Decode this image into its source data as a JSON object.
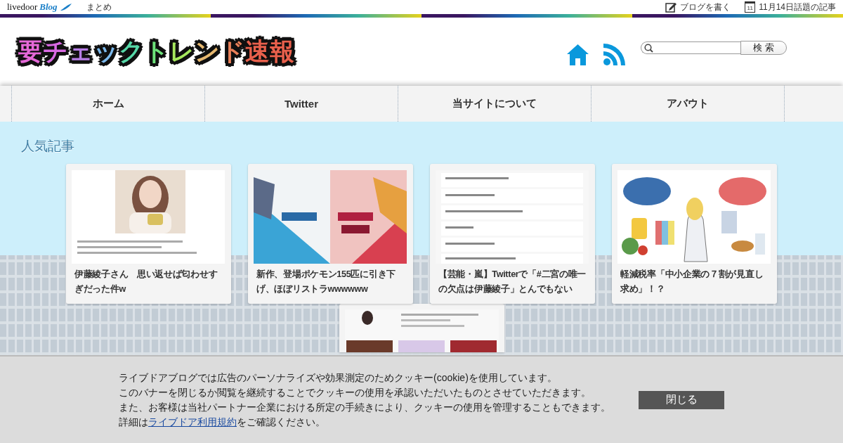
{
  "top_bar": {
    "brand": "livedoor",
    "brand_sub": "Blog",
    "link": "まとめ",
    "write_link": "ブログを書く",
    "calendar_day": "11",
    "topics_link": "11月14日話題の記事"
  },
  "header": {
    "site_title": "要チェックトレンド速報",
    "search": {
      "button": "検 索"
    }
  },
  "nav": {
    "items": [
      {
        "label": "ホーム"
      },
      {
        "label": "Twitter"
      },
      {
        "label": "当サイトについて"
      },
      {
        "label": "アバウト"
      }
    ]
  },
  "popular": {
    "title": "人気記事",
    "cards": [
      {
        "title": "伊藤綾子さん　思い返せば匂わせすぎだった件w"
      },
      {
        "title": "新作、登場ポケモン155匹に引き下げ、ほぼリストラwwwwww"
      },
      {
        "title": "【芸能・嵐】Twitterで「#二宮の唯一の欠点は伊藤綾子」とんでもない"
      },
      {
        "title": "軽減税率「中小企業の７割が見直し求め」！？"
      }
    ]
  },
  "cookie_banner": {
    "lines": [
      "ライブドアブログでは広告のパーソナライズや効果測定のためクッキー(cookie)を使用しています。",
      "このバナーを閉じるか閲覧を継続することでクッキーの使用を承認いただいたものとさせていただきます。",
      "また、お客様は当社パートナー企業における所定の手続きにより、クッキーの使用を管理することもできます。"
    ],
    "detail_prefix": "詳細は",
    "detail_link": "ライブドア利用規約",
    "detail_suffix": "をご確認ください。",
    "close_button": "閉じる"
  }
}
